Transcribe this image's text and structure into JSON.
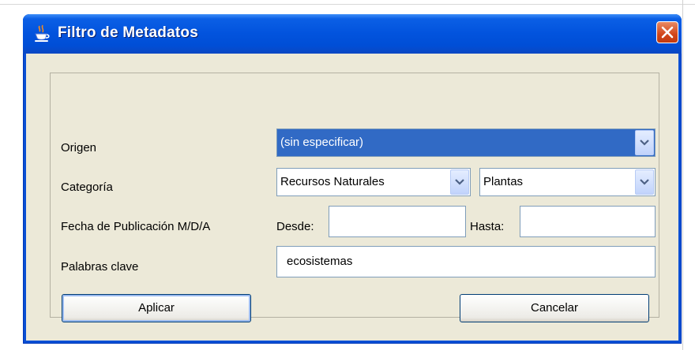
{
  "window": {
    "title": "Filtro de Metadatos",
    "icon": "java-cup-icon",
    "close_icon": "close-icon"
  },
  "form": {
    "origin": {
      "label": "Origen",
      "value": "(sin especificar)"
    },
    "category": {
      "label": "Categoría",
      "primary_value": "Recursos Naturales",
      "secondary_value": "Plantas"
    },
    "publication_date": {
      "label": "Fecha de Publicación M/D/A",
      "from_label": "Desde:",
      "from_value": "",
      "to_label": "Hasta:",
      "to_value": ""
    },
    "keywords": {
      "label": "Palabras clave",
      "value": "ecosistemas"
    }
  },
  "buttons": {
    "apply": "Aplicar",
    "cancel": "Cancelar"
  },
  "colors": {
    "titlebar": "#0054e3",
    "selection": "#316ac5",
    "dialog_bg": "#ece9d8",
    "close": "#d2461a"
  }
}
